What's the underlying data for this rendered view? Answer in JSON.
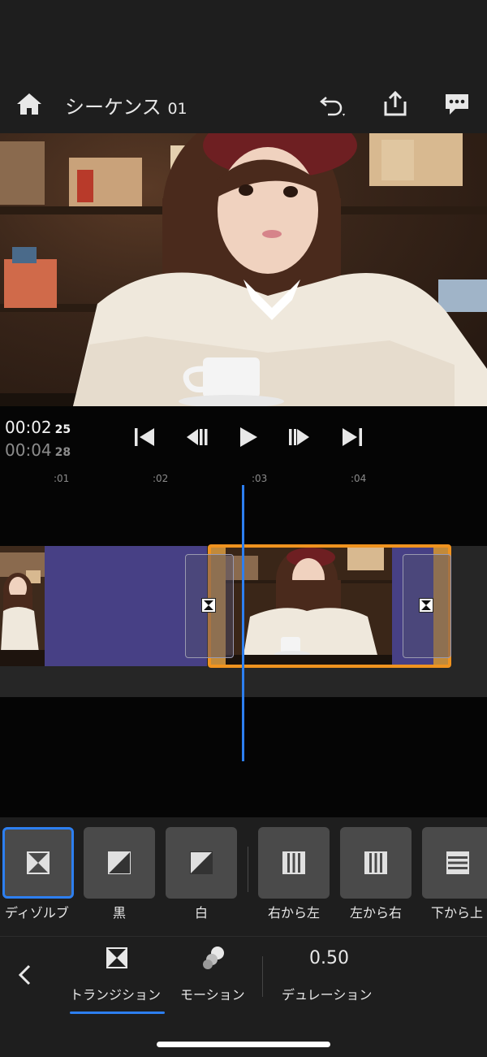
{
  "header": {
    "title_text": "シーケンス",
    "title_number": "01",
    "icons": [
      "home-icon",
      "undo-icon",
      "share-icon",
      "comment-icon"
    ]
  },
  "transport": {
    "current_time": "00:02",
    "current_frames": "25",
    "duration_time": "00:04",
    "duration_frames": "28",
    "icons": [
      "skip-to-start-icon",
      "step-back-icon",
      "play-icon",
      "step-forward-icon",
      "skip-to-end-icon"
    ]
  },
  "timeline": {
    "ruler": [
      ":01",
      ":02",
      ":03",
      ":04"
    ]
  },
  "transitions": {
    "items": [
      {
        "label": "ディゾルブ",
        "icon": "dissolve-icon",
        "selected": true
      },
      {
        "label": "黒",
        "icon": "fade-black-icon",
        "selected": false
      },
      {
        "label": "白",
        "icon": "fade-white-icon",
        "selected": false
      },
      {
        "label": "右から左",
        "icon": "wipe-right-to-left-icon",
        "selected": false
      },
      {
        "label": "左から右",
        "icon": "wipe-left-to-right-icon",
        "selected": false
      },
      {
        "label": "下から上",
        "icon": "wipe-bottom-to-top-icon",
        "selected": false
      }
    ]
  },
  "bottom_bar": {
    "transition_label": "トランジション",
    "motion_label": "モーション",
    "duration_value": "0.50",
    "duration_label": "デュレーション"
  },
  "colors": {
    "accent": "#2d7ff0",
    "clip_selected": "#f0931f",
    "clip_fill": "#474085"
  }
}
